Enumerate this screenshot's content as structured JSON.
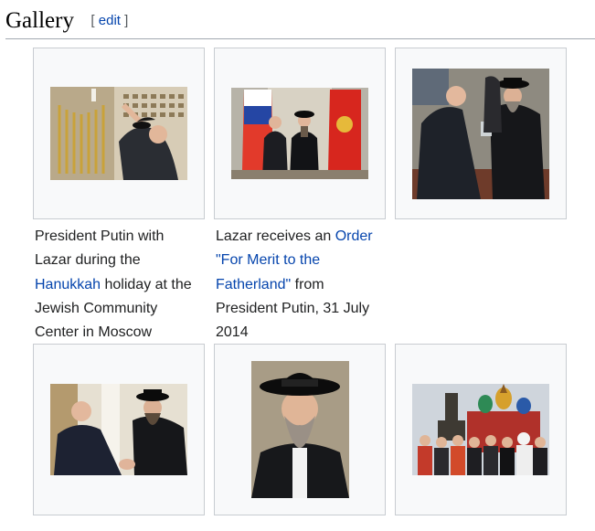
{
  "section": {
    "title": "Gallery",
    "edit_open": "[",
    "edit_label": "edit",
    "edit_close": "]"
  },
  "gallery": [
    {
      "caption": [
        {
          "text": "President Putin with Lazar during the ",
          "link": false
        },
        {
          "text": "Hanukkah",
          "link": true
        },
        {
          "text": " holiday at the Jewish Community Center in Moscow",
          "link": false
        }
      ]
    },
    {
      "caption": [
        {
          "text": "Lazar receives an ",
          "link": false
        },
        {
          "text": "Order \"For Merit to the Fatherland\"",
          "link": true
        },
        {
          "text": " from President Putin, 31 July 2014",
          "link": false
        }
      ]
    },
    {
      "caption": []
    },
    {
      "caption": []
    },
    {
      "caption": []
    },
    {
      "caption": []
    }
  ]
}
